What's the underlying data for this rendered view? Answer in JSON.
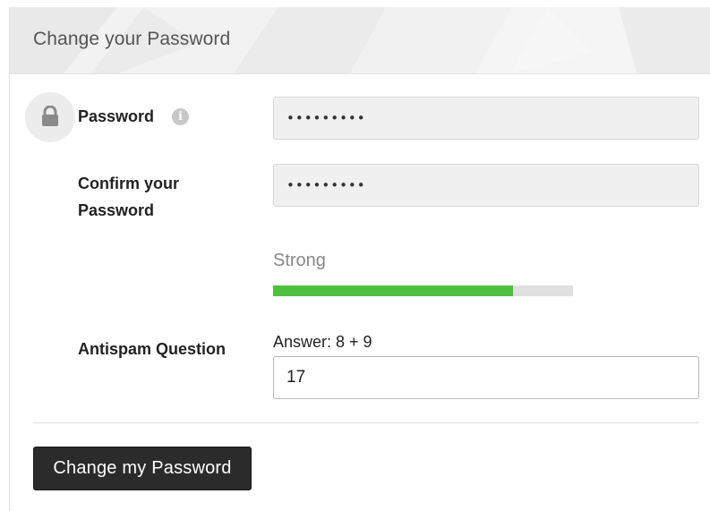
{
  "panel": {
    "title": "Change your Password"
  },
  "form": {
    "password": {
      "label": "Password",
      "value": "•••••••••",
      "icon": "lock-icon",
      "info_icon": "info-icon",
      "info_glyph": "i"
    },
    "confirm": {
      "label_line1": "Confirm your",
      "label_line2": "Password",
      "value": "•••••••••"
    },
    "strength": {
      "label": "Strong",
      "level": 0.8,
      "color": "#4fbf40"
    },
    "antispam": {
      "label": "Antispam Question",
      "hint": "Answer: 8 + 9",
      "value": "17"
    },
    "submit_label": "Change my Password"
  },
  "colors": {
    "header_bg": "#eeeeee",
    "button_bg": "#2b2b2b",
    "field_bg": "#f0f0f0"
  }
}
